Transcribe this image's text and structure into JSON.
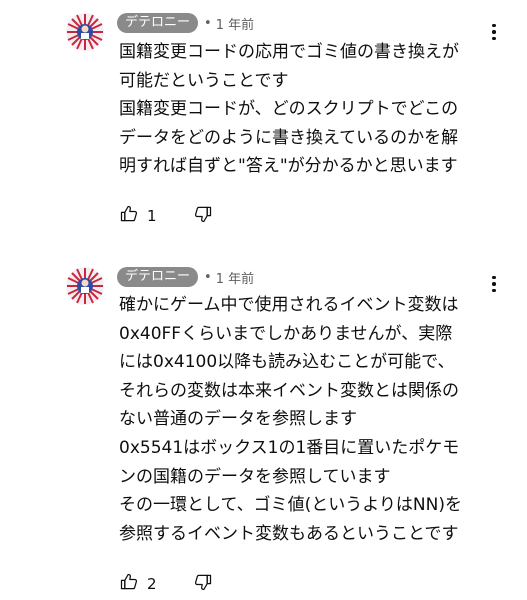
{
  "comments": [
    {
      "author": "デテロニー",
      "separator": "•",
      "time": "1 年前",
      "lines": [
        "国籍変更コードの応用でゴミ値の書き換えが",
        "可能だということです",
        "国籍変更コードが、どのスクリプトでどこの",
        "データをどのように書き換えているのかを解",
        "明すれば自ずと\"答え\"が分かるかと思います"
      ],
      "likes": "1",
      "icons": {
        "avatar": "avatar-image",
        "like": "thumbs-up-icon",
        "dislike": "thumbs-down-icon",
        "more": "more-vert-icon"
      }
    },
    {
      "author": "デテロニー",
      "separator": "•",
      "time": "1 年前",
      "lines": [
        "確かにゲーム中で使用されるイベント変数は",
        "0x40FFくらいまでしかありませんが、実際",
        "には0x4100以降も読み込むことが可能で、",
        "それらの変数は本来イベント変数とは関係の",
        "ない普通のデータを参照します",
        "0x5541はボックス1の1番目に置いたポケモ",
        "ンの国籍のデータを参照しています",
        "その一環として、ゴミ値(というよりはNN)を",
        "参照するイベント変数もあるということです"
      ],
      "likes": "2",
      "icons": {
        "avatar": "avatar-image",
        "like": "thumbs-up-icon",
        "dislike": "thumbs-down-icon",
        "more": "more-vert-icon"
      }
    }
  ],
  "colors": {
    "author_badge": "#8a8a8a",
    "meta_text": "#606060",
    "text": "#0f0f0f",
    "background": "#ffffff"
  }
}
